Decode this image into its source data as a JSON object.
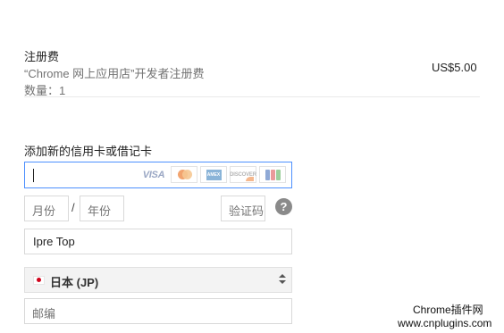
{
  "order": {
    "title": "注册费",
    "subtitle": "“Chrome 网上应用店”开发者注册费",
    "quantity": "数量：1",
    "price": "US$5.00"
  },
  "card_section": {
    "label": "添加新的信用卡或借记卡",
    "card_number_value": "",
    "logos": {
      "visa": "VISA",
      "amex": "AMEX",
      "discover": "DISCOVER"
    }
  },
  "expiry": {
    "month_placeholder": "月份",
    "separator": "/",
    "year_placeholder": "年份"
  },
  "cvc": {
    "placeholder": "验证码",
    "help_glyph": "?"
  },
  "cardholder": {
    "name_value": "Ipre Top"
  },
  "country": {
    "selected": "日本 (JP)"
  },
  "postal": {
    "placeholder": "邮编"
  },
  "watermark": {
    "line1": "Chrome插件网",
    "line2": "www.cnplugins.com"
  },
  "colors": {
    "focus_border": "#4d90fe",
    "muted_text": "#737373",
    "help_icon_bg": "#8a8a8a"
  }
}
